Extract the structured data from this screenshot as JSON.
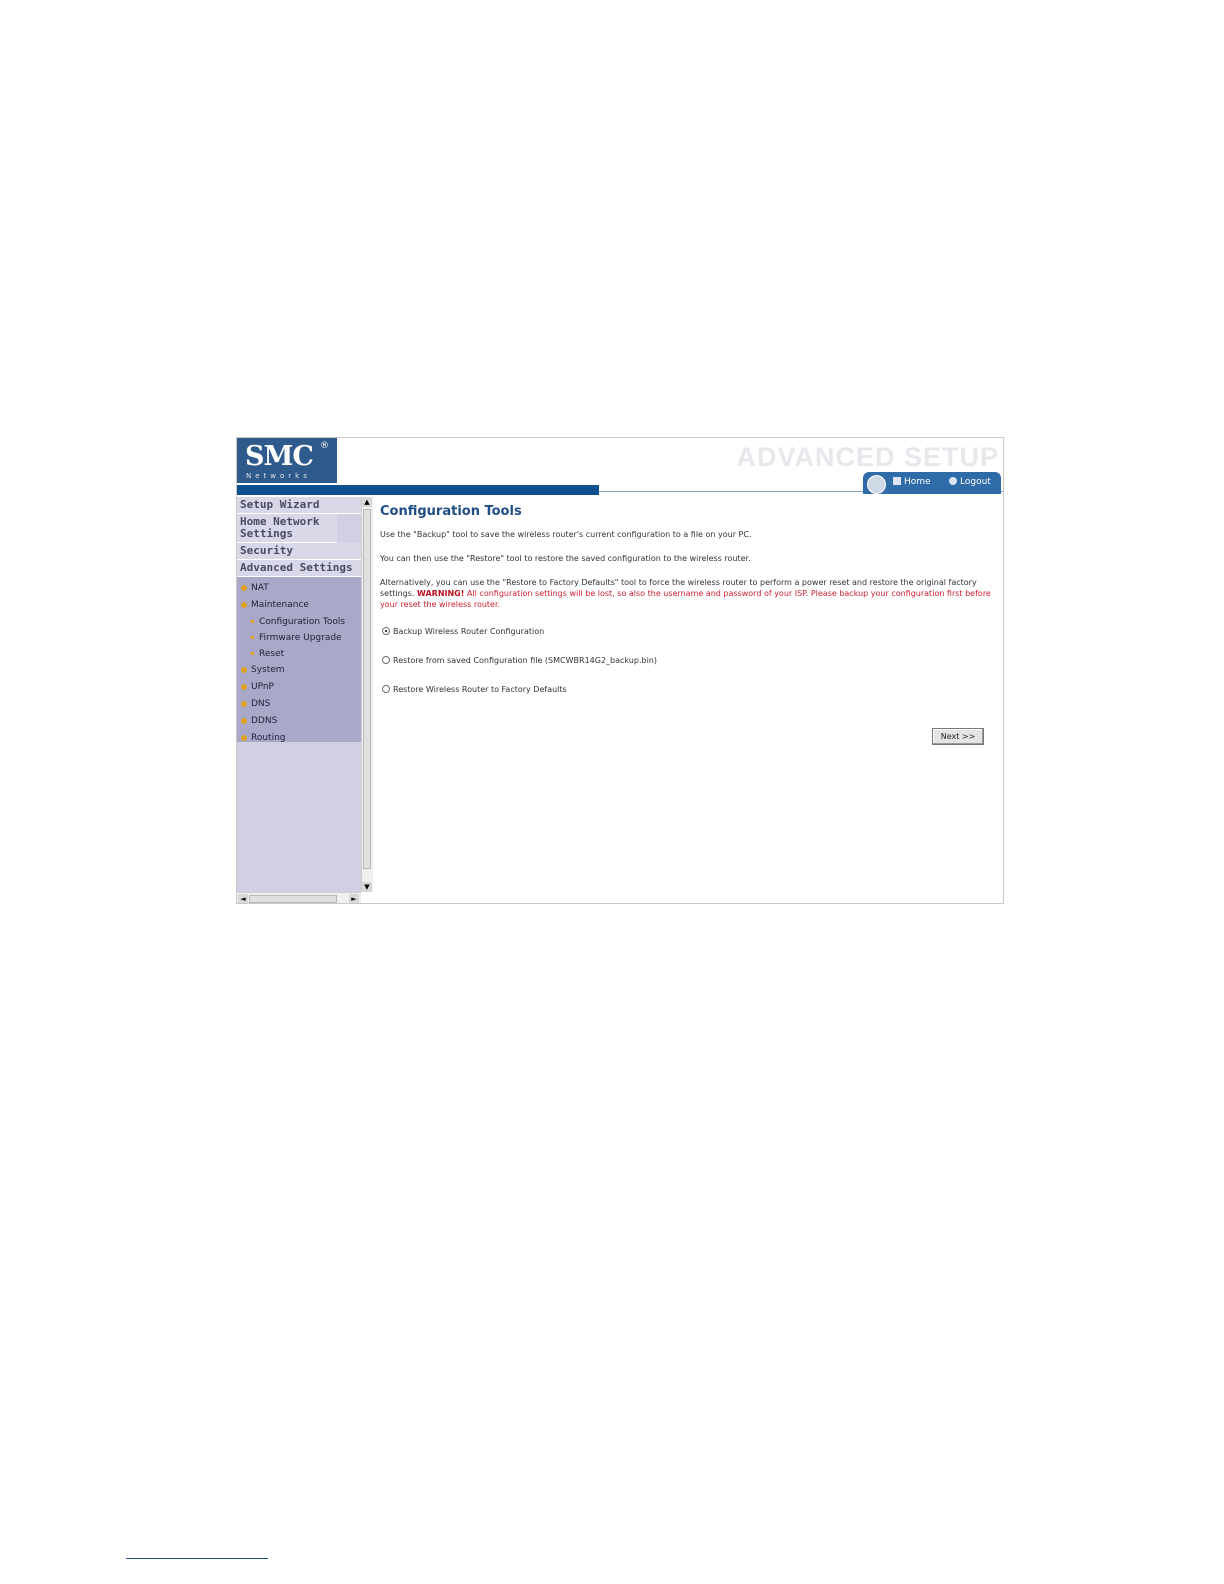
{
  "header": {
    "logo": "SMC",
    "logo_reg": "®",
    "logo_sub": "Networks",
    "title": "ADVANCED SETUP",
    "home_label": "Home",
    "logout_label": "Logout"
  },
  "sidebar": {
    "sections": [
      "Setup Wizard",
      "Home Network Settings",
      "Security",
      "Advanced Settings"
    ],
    "sub_items": [
      "NAT",
      "Maintenance",
      "System",
      "UPnP",
      "DNS",
      "DDNS",
      "Routing"
    ],
    "maintenance_children": [
      "Configuration Tools",
      "Firmware Upgrade",
      "Reset"
    ]
  },
  "main": {
    "title": "Configuration Tools",
    "para1": "Use the \"Backup\" tool to save the wireless router's current configuration to a file on your PC.",
    "para2": "You can then use the \"Restore\" tool to restore the saved configuration to the wireless router.",
    "para3_normal": "Alternatively, you can use the \"Restore to Factory Defaults\" tool to force the wireless router to perform a power reset and restore the original factory settings.",
    "para3_warn_label": "WARNING!",
    "para3_warn_text": "All configuration settings will be lost, so also the username and password of your ISP. Please backup your configuration first before your reset the wireless router.",
    "options": [
      {
        "label": "Backup Wireless Router Configuration",
        "selected": true
      },
      {
        "label": "Restore from saved Configuration file (SMCWBR14G2_backup.bin)",
        "selected": false
      },
      {
        "label": "Restore Wireless Router to Factory Defaults",
        "selected": false
      }
    ],
    "next_label": "Next >>"
  },
  "colors": {
    "brand_blue": "#0e4f8f",
    "title_blue": "#1f4d86",
    "warning_red": "#d02030",
    "sidebar_bg": "#a9a8c8"
  }
}
